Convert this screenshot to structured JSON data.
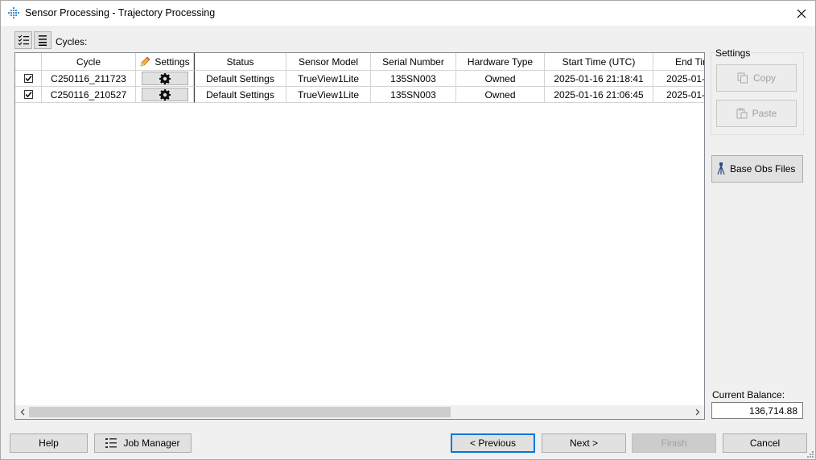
{
  "window": {
    "title": "Sensor Processing - Trajectory Processing"
  },
  "toolbar": {
    "cycles_label": "Cycles:"
  },
  "table": {
    "columns": [
      "Cycle",
      "Settings",
      "Status",
      "Sensor Model",
      "Serial Number",
      "Hardware Type",
      "Start Time (UTC)",
      "End Tir"
    ],
    "rows": [
      {
        "checked": true,
        "cycle": "C250116_211723",
        "status": "Default Settings",
        "sensor_model": "TrueView1Lite",
        "serial": "135SN003",
        "hardware": "Owned",
        "start": "2025-01-16 21:18:41",
        "end": "2025-01-"
      },
      {
        "checked": true,
        "cycle": "C250116_210527",
        "status": "Default Settings",
        "sensor_model": "TrueView1Lite",
        "serial": "135SN003",
        "hardware": "Owned",
        "start": "2025-01-16 21:06:45",
        "end": "2025-01-"
      }
    ]
  },
  "side": {
    "settings_group": "Settings",
    "copy": "Copy",
    "paste": "Paste",
    "base_obs": "Base Obs Files",
    "balance_label": "Current Balance:",
    "balance_value": "136,714.88"
  },
  "footer": {
    "help": "Help",
    "job_manager": "Job Manager",
    "previous": "< Previous",
    "next": "Next >",
    "finish": "Finish",
    "cancel": "Cancel"
  },
  "colors": {
    "accent": "#0078d7",
    "disabled_text": "#a0a0a0"
  }
}
